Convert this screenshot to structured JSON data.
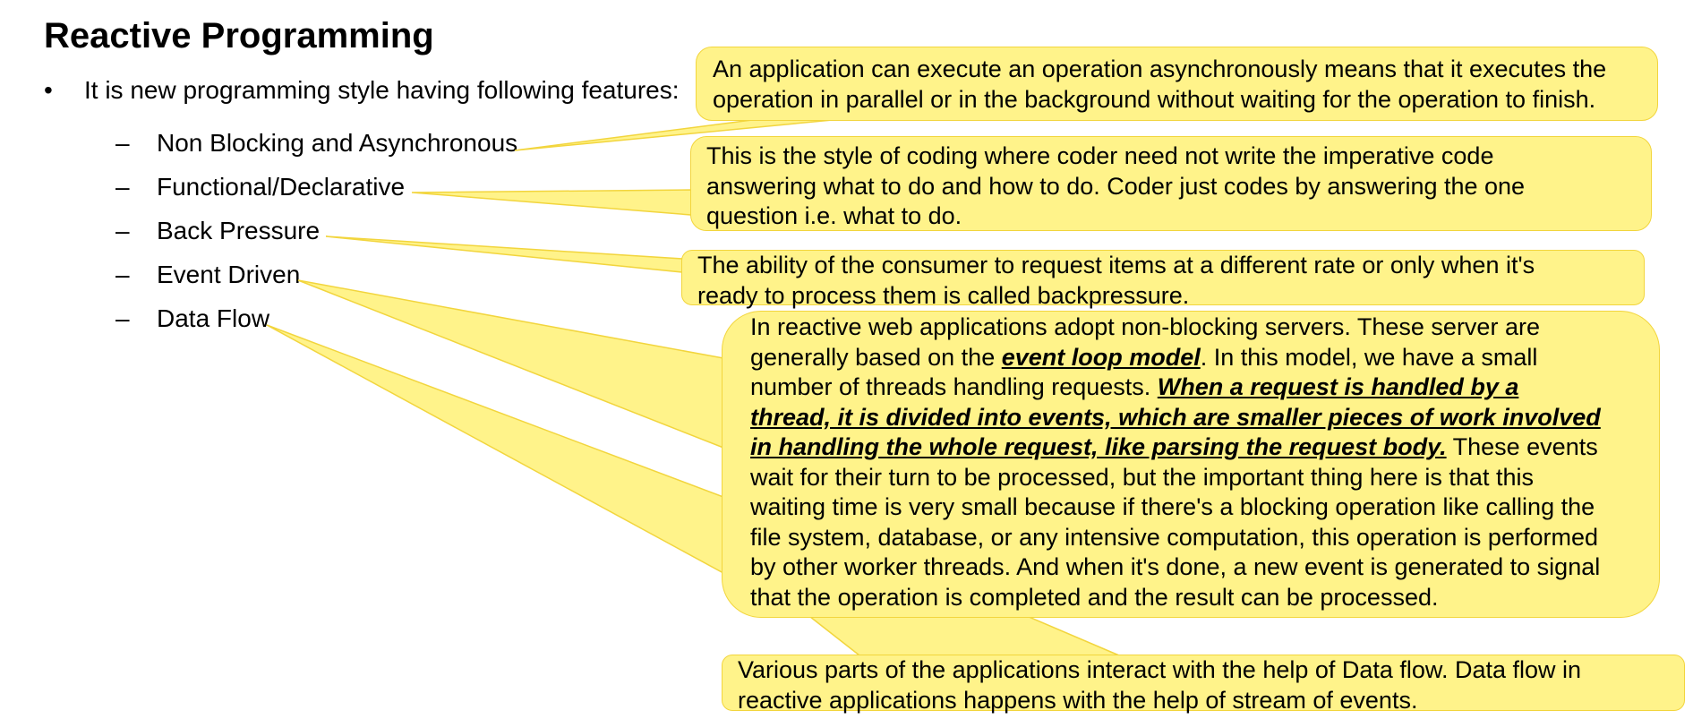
{
  "title": "Reactive Programming",
  "intro": {
    "bullet": "•",
    "text": "It is new programming style having following features:"
  },
  "features": {
    "dash": "–",
    "items": [
      "Non Blocking and Asynchronous",
      "Functional/Declarative",
      "Back Pressure",
      "Event Driven",
      "Data Flow"
    ]
  },
  "callouts": {
    "non_blocking": {
      "lines": [
        "An application can execute an operation asynchronously means that it executes the",
        "operation in parallel or in the background without waiting for the operation to finish."
      ]
    },
    "functional": {
      "lines": [
        "This is the style of coding where coder need not write the imperative code",
        "answering what to do and how to do. Coder just codes by answering the one",
        "question i.e. what to do."
      ]
    },
    "back_pressure": {
      "lines": [
        "The ability of the consumer to request items at a different rate or only when it's",
        "ready to process them is called backpressure."
      ]
    },
    "event_driven": {
      "line1": "In reactive web applications adopt non-blocking servers. These server are",
      "line2_pre": "generally based on the ",
      "line2_em": "event loop model",
      "line2_post": ". In this model, we have a small",
      "line3_pre": "number of threads handling requests. ",
      "line3_em": "When a request is handled by a",
      "line4_em": "thread, it is divided into events, which are smaller pieces of work involved",
      "line5_em": "in handling the whole request, like parsing the request body.",
      "line5_post": " These events",
      "line6": "wait for their turn to be processed, but the important thing here is that this",
      "line7": "waiting time is very small because if there's a blocking operation like calling the",
      "line8": "file system, database, or any intensive computation, this operation is performed",
      "line9": "by other worker threads. And when it's done, a new event is generated to signal",
      "line10": "that the operation is completed and the result can be processed."
    },
    "data_flow": {
      "lines": [
        "Various parts of the applications interact with the help of Data flow. Data flow in",
        "reactive applications happens with the help of stream of events."
      ]
    }
  },
  "colors": {
    "callout_fill": "#fff38a",
    "callout_border": "#f2d53d"
  }
}
